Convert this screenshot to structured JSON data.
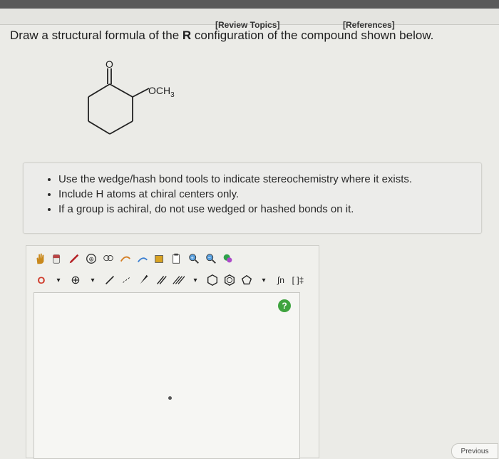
{
  "nav": {
    "review_topics": "[Review Topics]",
    "references": "[References]"
  },
  "question": {
    "prefix": "Draw a structural formula of the ",
    "bold": "R",
    "suffix": " configuration of the compound shown below."
  },
  "molecule": {
    "carbonyl_oxygen": "O",
    "substituent": "OCH",
    "substituent_subscript": "3"
  },
  "instructions": [
    "Use the wedge/hash bond tools to indicate stereochemistry where it exists.",
    "Include H atoms at chiral centers only.",
    "If a group is achiral, do not use wedged or hashed bonds on it."
  ],
  "toolbar": {
    "row1_icons": [
      "hand-icon",
      "eraser-icon",
      "pencil-icon",
      "atom-ring-icon",
      "template-icon",
      "arrow-icon",
      "cut-icon",
      "copy-icon",
      "paste-icon",
      "zoom-in-icon",
      "zoom-out-icon",
      "color-icon"
    ],
    "row2": {
      "atom_label": "O",
      "plus_label": "⊕",
      "symbol_label": "∫n",
      "bracket_label": "[ ]‡"
    }
  },
  "help_label": "?",
  "previous_label": "Previous"
}
